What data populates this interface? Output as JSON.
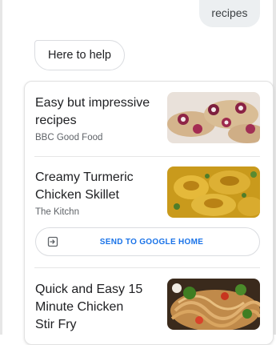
{
  "conversation": {
    "user_query": "recipes",
    "assistant_reply": "Here to help"
  },
  "recipes": [
    {
      "title_lines": [
        "Easy but impressive",
        "recipes"
      ],
      "source": "BBC Good Food",
      "image_icon": "figs-on-toast-image"
    },
    {
      "title_lines": [
        "Creamy Turmeric",
        "Chicken Skillet"
      ],
      "source": "The Kitchn",
      "image_icon": "turmeric-chicken-image"
    },
    {
      "title_lines": [
        "Quick and Easy 15",
        "Minute Chicken",
        "Stir Fry"
      ],
      "source": "",
      "image_icon": "stir-fry-noodles-image"
    }
  ],
  "actions": {
    "send_to_home": "SEND TO GOOGLE HOME",
    "send_icon": "cast-to-device-icon"
  },
  "colors": {
    "accent": "#1a73e8",
    "bubble_bg": "#eceff1",
    "border": "#dadce0"
  }
}
